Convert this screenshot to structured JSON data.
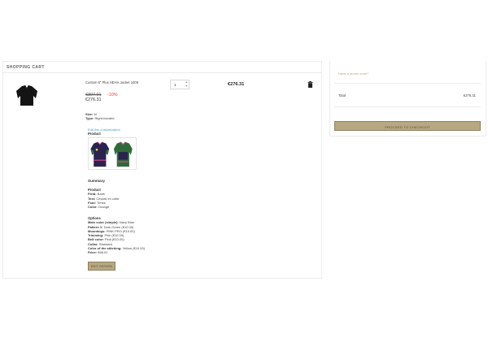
{
  "cart": {
    "header": "SHOPPING CART",
    "item": {
      "name": "Custom 6\" Plus HEHA Jacket 1009",
      "old_price": "€307.01",
      "discount": "-10%",
      "price": "€276.31",
      "quantity": "1",
      "line_total": "€276.31",
      "size_label": "Size:",
      "size_value": "M",
      "type_label": "Type:",
      "type_value": "Right-handed",
      "edit_link": "Edit this customization",
      "product_label": "Product"
    },
    "summary": {
      "title": "Summary",
      "product_heading": "Product",
      "product_rows": [
        {
          "k": "Field:",
          "v": "Bank"
        },
        {
          "k": "Text:",
          "v": "Cesard en colle"
        },
        {
          "k": "Font:",
          "v": "Times"
        },
        {
          "k": "Color:",
          "v": "Orange"
        }
      ],
      "options_heading": "Options",
      "option_rows": [
        {
          "k": "Main color (simple):",
          "v": "Navy Blue"
        },
        {
          "k": "Pattern 1:",
          "v": "Dark Green (€10.00)"
        },
        {
          "k": "Mountings:",
          "v": "PINK PRO (€10.00)"
        },
        {
          "k": "Trimming:",
          "v": "Pink (€10.00)"
        },
        {
          "k": "Belt color:",
          "v": "Pink (€10.00)"
        },
        {
          "k": "Collar:",
          "v": "Standard"
        },
        {
          "k": "Color of the stitching:",
          "v": "Yellow (€10.00)"
        },
        {
          "k": "Price:",
          "v": "€66.02"
        }
      ],
      "edit_button": "EDIT DESIGN"
    }
  },
  "side": {
    "promo_link": "Have a promo code?",
    "total_label": "Total",
    "total_value": "€276.31",
    "checkout_button": "PROCEED TO CHECKOUT"
  },
  "colors": {
    "accent": "#b7a783",
    "discount": "#e03a3a",
    "link": "#3aa1c6",
    "jacket_navy": "#2a2250",
    "jacket_green": "#2f6b3a"
  }
}
